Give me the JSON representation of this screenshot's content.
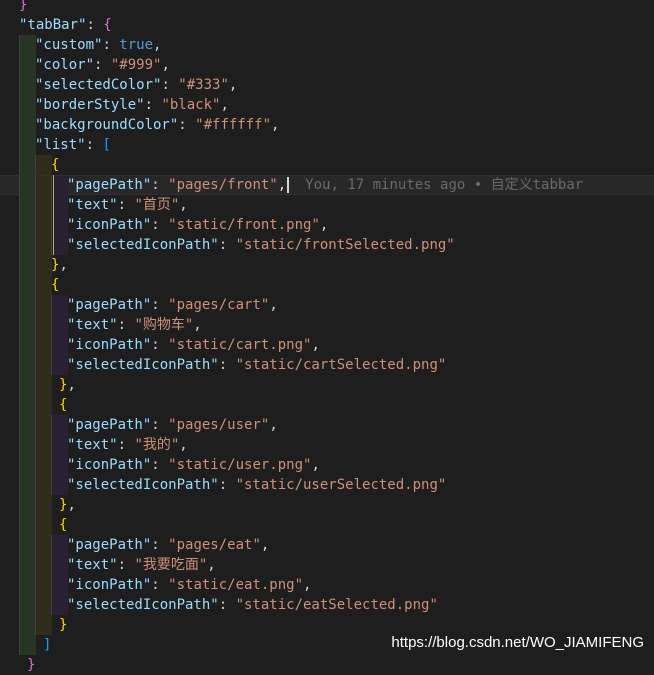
{
  "editor": {
    "lines": [
      {
        "indent": 0,
        "tokens": [
          {
            "t": "}",
            "c": "b2"
          }
        ]
      },
      {
        "indent": 0,
        "tokens": [
          {
            "t": "\"tabBar\"",
            "c": "key"
          },
          {
            "t": ": ",
            "c": "punc"
          },
          {
            "t": "{",
            "c": "b2"
          }
        ]
      },
      {
        "indent": 1,
        "tokens": [
          {
            "t": "\"custom\"",
            "c": "key"
          },
          {
            "t": ": ",
            "c": "punc"
          },
          {
            "t": "true",
            "c": "kw"
          },
          {
            "t": ",",
            "c": "punc"
          }
        ]
      },
      {
        "indent": 1,
        "tokens": [
          {
            "t": "\"color\"",
            "c": "key"
          },
          {
            "t": ": ",
            "c": "punc"
          },
          {
            "t": "\"#999\"",
            "c": "str"
          },
          {
            "t": ",",
            "c": "punc"
          }
        ]
      },
      {
        "indent": 1,
        "tokens": [
          {
            "t": "\"selectedColor\"",
            "c": "key"
          },
          {
            "t": ": ",
            "c": "punc"
          },
          {
            "t": "\"#333\"",
            "c": "str"
          },
          {
            "t": ",",
            "c": "punc"
          }
        ]
      },
      {
        "indent": 1,
        "tokens": [
          {
            "t": "\"borderStyle\"",
            "c": "key"
          },
          {
            "t": ": ",
            "c": "punc"
          },
          {
            "t": "\"black\"",
            "c": "str"
          },
          {
            "t": ",",
            "c": "punc"
          }
        ]
      },
      {
        "indent": 1,
        "tokens": [
          {
            "t": "\"backgroundColor\"",
            "c": "key"
          },
          {
            "t": ": ",
            "c": "punc"
          },
          {
            "t": "\"#ffffff\"",
            "c": "str"
          },
          {
            "t": ",",
            "c": "punc"
          }
        ]
      },
      {
        "indent": 1,
        "tokens": [
          {
            "t": "\"list\"",
            "c": "key"
          },
          {
            "t": ": ",
            "c": "punc"
          },
          {
            "t": "[",
            "c": "b3"
          }
        ]
      },
      {
        "indent": 2,
        "tokens": [
          {
            "t": "{",
            "c": "b1"
          }
        ]
      },
      {
        "indent": 3,
        "current": true,
        "tokens": [
          {
            "t": "\"pagePath\"",
            "c": "key"
          },
          {
            "t": ": ",
            "c": "punc"
          },
          {
            "t": "\"pages/front\"",
            "c": "str"
          },
          {
            "t": ",",
            "c": "punc"
          }
        ],
        "blame": "You, 17 minutes ago • 自定义tabbar"
      },
      {
        "indent": 3,
        "tokens": [
          {
            "t": "\"text\"",
            "c": "key"
          },
          {
            "t": ": ",
            "c": "punc"
          },
          {
            "t": "\"首页\"",
            "c": "str"
          },
          {
            "t": ",",
            "c": "punc"
          }
        ]
      },
      {
        "indent": 3,
        "tokens": [
          {
            "t": "\"iconPath\"",
            "c": "key"
          },
          {
            "t": ": ",
            "c": "punc"
          },
          {
            "t": "\"static/front.png\"",
            "c": "str"
          },
          {
            "t": ",",
            "c": "punc"
          }
        ]
      },
      {
        "indent": 3,
        "tokens": [
          {
            "t": "\"selectedIconPath\"",
            "c": "key"
          },
          {
            "t": ": ",
            "c": "punc"
          },
          {
            "t": "\"static/frontSelected.png\"",
            "c": "str"
          }
        ]
      },
      {
        "indent": 2,
        "tokens": [
          {
            "t": "}",
            "c": "b1"
          },
          {
            "t": ",",
            "c": "punc"
          }
        ]
      },
      {
        "indent": 2,
        "tokens": [
          {
            "t": "{",
            "c": "b1"
          }
        ]
      },
      {
        "indent": 3,
        "tokens": [
          {
            "t": "\"pagePath\"",
            "c": "key"
          },
          {
            "t": ": ",
            "c": "punc"
          },
          {
            "t": "\"pages/cart\"",
            "c": "str"
          },
          {
            "t": ",",
            "c": "punc"
          }
        ]
      },
      {
        "indent": 3,
        "tokens": [
          {
            "t": "\"text\"",
            "c": "key"
          },
          {
            "t": ": ",
            "c": "punc"
          },
          {
            "t": "\"购物车\"",
            "c": "str"
          },
          {
            "t": ",",
            "c": "punc"
          }
        ]
      },
      {
        "indent": 3,
        "tokens": [
          {
            "t": "\"iconPath\"",
            "c": "key"
          },
          {
            "t": ": ",
            "c": "punc"
          },
          {
            "t": "\"static/cart.png\"",
            "c": "str"
          },
          {
            "t": ",",
            "c": "punc"
          }
        ]
      },
      {
        "indent": 3,
        "tokens": [
          {
            "t": "\"selectedIconPath\"",
            "c": "key"
          },
          {
            "t": ": ",
            "c": "punc"
          },
          {
            "t": "\"static/cartSelected.png\"",
            "c": "str"
          }
        ]
      },
      {
        "indent": 2.5,
        "tokens": [
          {
            "t": "}",
            "c": "b1"
          },
          {
            "t": ",",
            "c": "punc"
          }
        ]
      },
      {
        "indent": 2.5,
        "tokens": [
          {
            "t": "{",
            "c": "b1"
          }
        ]
      },
      {
        "indent": 3,
        "tokens": [
          {
            "t": "\"pagePath\"",
            "c": "key"
          },
          {
            "t": ": ",
            "c": "punc"
          },
          {
            "t": "\"pages/user\"",
            "c": "str"
          },
          {
            "t": ",",
            "c": "punc"
          }
        ]
      },
      {
        "indent": 3,
        "tokens": [
          {
            "t": "\"text\"",
            "c": "key"
          },
          {
            "t": ": ",
            "c": "punc"
          },
          {
            "t": "\"我的\"",
            "c": "str"
          },
          {
            "t": ",",
            "c": "punc"
          }
        ]
      },
      {
        "indent": 3,
        "tokens": [
          {
            "t": "\"iconPath\"",
            "c": "key"
          },
          {
            "t": ": ",
            "c": "punc"
          },
          {
            "t": "\"static/user.png\"",
            "c": "str"
          },
          {
            "t": ",",
            "c": "punc"
          }
        ]
      },
      {
        "indent": 3,
        "tokens": [
          {
            "t": "\"selectedIconPath\"",
            "c": "key"
          },
          {
            "t": ": ",
            "c": "punc"
          },
          {
            "t": "\"static/userSelected.png\"",
            "c": "str"
          }
        ]
      },
      {
        "indent": 2.5,
        "tokens": [
          {
            "t": "}",
            "c": "b1"
          },
          {
            "t": ",",
            "c": "punc"
          }
        ]
      },
      {
        "indent": 2.5,
        "tokens": [
          {
            "t": "{",
            "c": "b1"
          }
        ]
      },
      {
        "indent": 3,
        "tokens": [
          {
            "t": "\"pagePath\"",
            "c": "key"
          },
          {
            "t": ": ",
            "c": "punc"
          },
          {
            "t": "\"pages/eat\"",
            "c": "str"
          },
          {
            "t": ",",
            "c": "punc"
          }
        ]
      },
      {
        "indent": 3,
        "tokens": [
          {
            "t": "\"text\"",
            "c": "key"
          },
          {
            "t": ": ",
            "c": "punc"
          },
          {
            "t": "\"我要吃面\"",
            "c": "str"
          },
          {
            "t": ",",
            "c": "punc"
          }
        ]
      },
      {
        "indent": 3,
        "tokens": [
          {
            "t": "\"iconPath\"",
            "c": "key"
          },
          {
            "t": ": ",
            "c": "punc"
          },
          {
            "t": "\"static/eat.png\"",
            "c": "str"
          },
          {
            "t": ",",
            "c": "punc"
          }
        ]
      },
      {
        "indent": 3,
        "tokens": [
          {
            "t": "\"selectedIconPath\"",
            "c": "key"
          },
          {
            "t": ": ",
            "c": "punc"
          },
          {
            "t": "\"static/eatSelected.png\"",
            "c": "str"
          }
        ]
      },
      {
        "indent": 2.5,
        "tokens": [
          {
            "t": "}",
            "c": "b1"
          }
        ]
      },
      {
        "indent": 1.5,
        "tokens": [
          {
            "t": "]",
            "c": "b3"
          }
        ]
      },
      {
        "indent": 0.5,
        "tokens": [
          {
            "t": "}",
            "c": "b2"
          }
        ]
      }
    ]
  },
  "guide_colors": [
    "#263524",
    "#2f2b1d",
    "#2a2034",
    "#1f2b36"
  ],
  "watermark": "https://blog.csdn.net/WO_JIAMIFENG"
}
